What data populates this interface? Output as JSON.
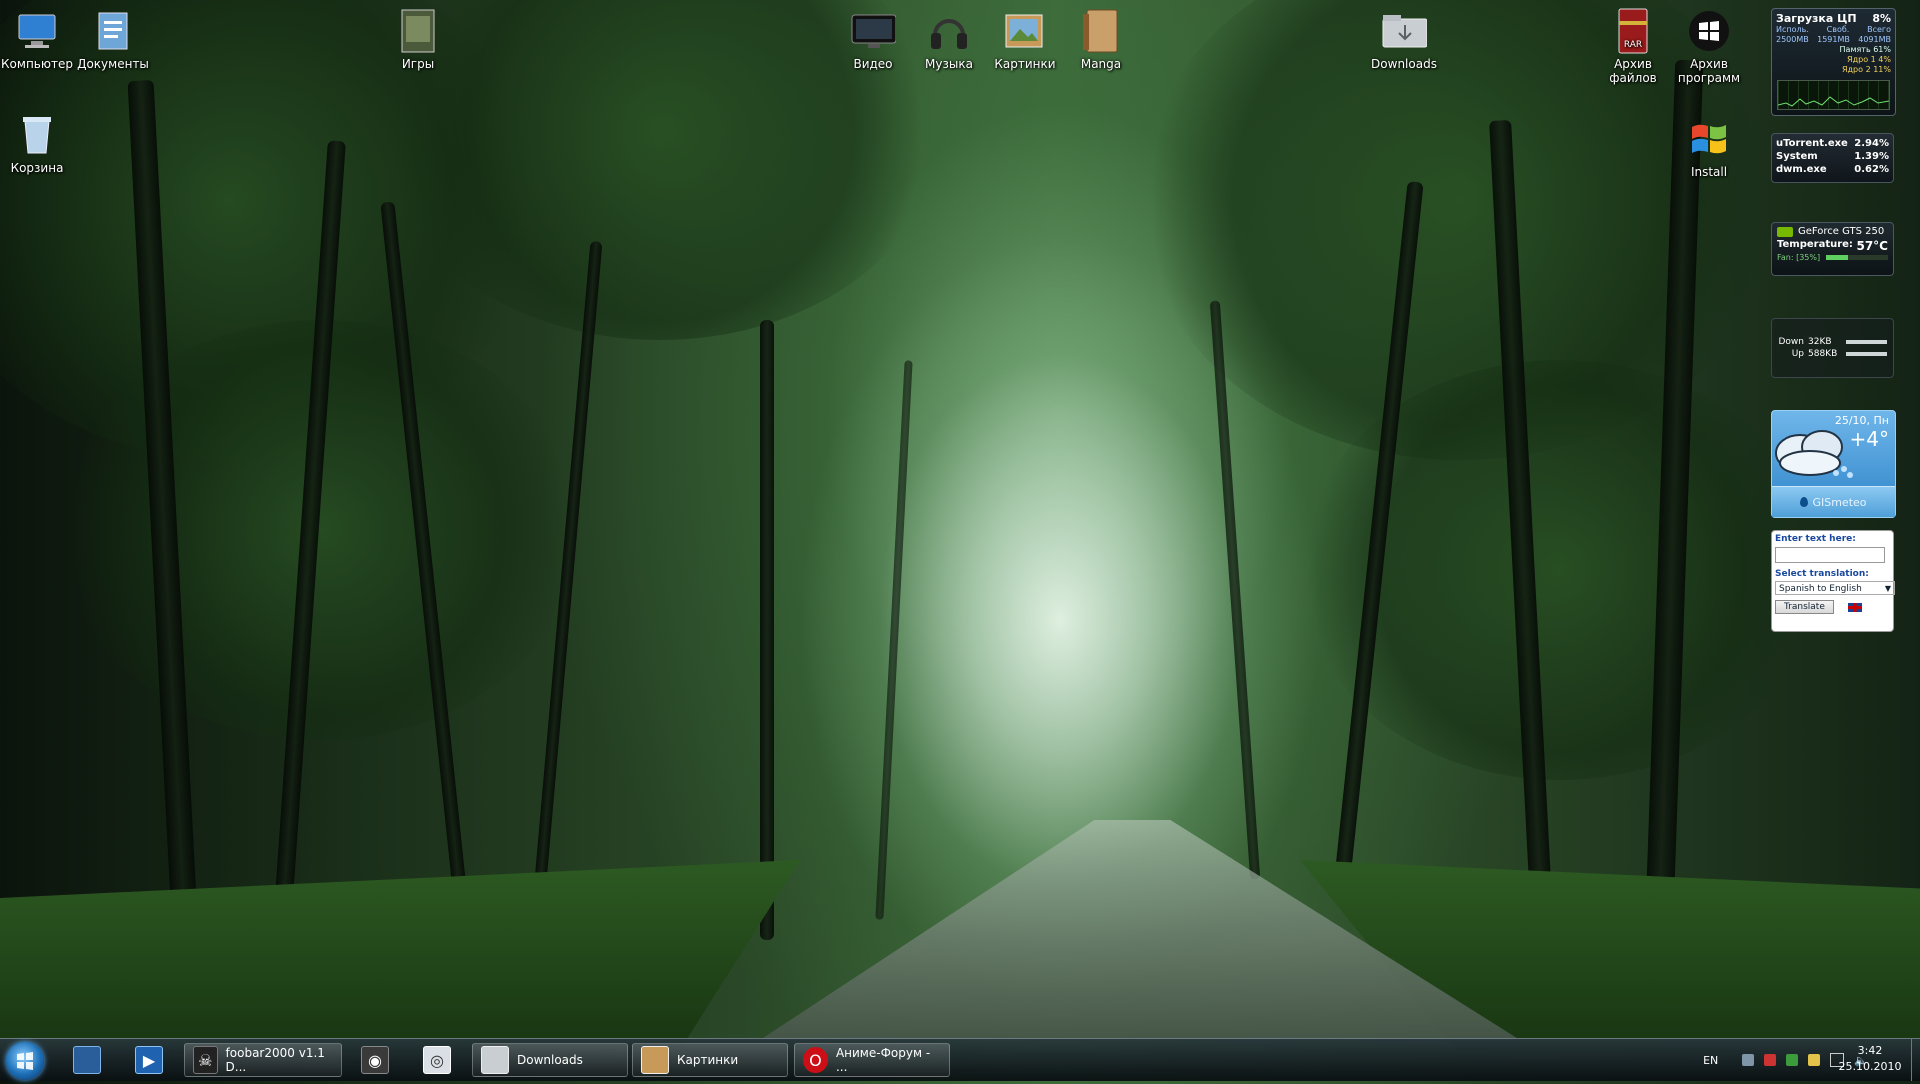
{
  "desktop_icons": [
    {
      "label": "Компьютер",
      "icon": "computer-icon"
    },
    {
      "label": "Документы",
      "icon": "documents-icon"
    },
    {
      "label": "Корзина",
      "icon": "recycle-bin-icon"
    },
    {
      "label": "Игры",
      "icon": "games-icon"
    },
    {
      "label": "Видео",
      "icon": "video-icon"
    },
    {
      "label": "Музыка",
      "icon": "music-icon"
    },
    {
      "label": "Картинки",
      "icon": "pictures-icon"
    },
    {
      "label": "Manga",
      "icon": "manga-icon"
    },
    {
      "label": "Downloads",
      "icon": "downloads-icon"
    },
    {
      "label": "Архив файлов",
      "icon": "winrar-icon"
    },
    {
      "label": "Архив программ",
      "icon": "windows-logo-icon"
    },
    {
      "label": "Install",
      "icon": "windows-flag-icon"
    }
  ],
  "gadgets": {
    "cpu": {
      "title": "Загрузка ЦП",
      "percent": "8%",
      "col_used": "Исполь.",
      "col_free": "Своб.",
      "col_total": "Всего",
      "used": "2500MB",
      "free": "1591MB",
      "total": "4091MB",
      "memory_label": "Память",
      "memory_value": "61%",
      "core1_label": "Ядро 1",
      "core1_value": "4%",
      "core2_label": "Ядро 2",
      "core2_value": "11%"
    },
    "processes": [
      {
        "name": "uTorrent.exe",
        "value": "2.94%"
      },
      {
        "name": "System",
        "value": "1.39%"
      },
      {
        "name": "dwm.exe",
        "value": "0.62%"
      }
    ],
    "gpu": {
      "name": "GeForce GTS 250",
      "temp_label": "Temperature:",
      "temp_value": "57°C",
      "fan": "Fan: [35%]",
      "fan_level": 0.35
    },
    "network": {
      "down_label": "Down",
      "down_value": "32KB",
      "up_label": "Up",
      "up_value": "588KB"
    },
    "weather": {
      "date": "25/10, Пн",
      "temp": "+4°",
      "brand": "GISmeteo"
    },
    "translator": {
      "enter_label": "Enter text here:",
      "select_label": "Select translation:",
      "selected": "Spanish to English",
      "button": "Translate"
    }
  },
  "taskbar": {
    "windows": [
      {
        "label": "foobar2000 v1.1 D...",
        "icon": "foobar-icon"
      },
      {
        "label": "Downloads",
        "icon": "folder-icon"
      },
      {
        "label": "Картинки",
        "icon": "pictures-folder-icon"
      },
      {
        "label": "Аниме-Форум - ...",
        "icon": "opera-icon"
      }
    ],
    "language": "EN",
    "time": "3:42",
    "date": "25.10.2010"
  },
  "colors": {
    "accent": "#1d6fb8",
    "opera_red": "#cc0f16"
  }
}
